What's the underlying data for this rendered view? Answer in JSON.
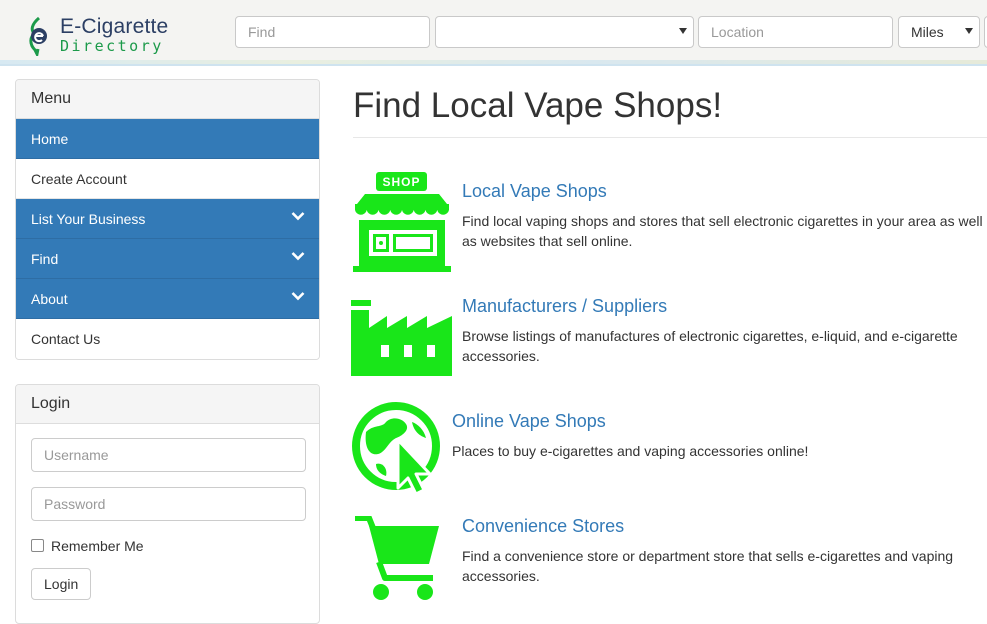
{
  "header": {
    "logo_line1": "E-Cigarette",
    "logo_line2": "Directory",
    "find_placeholder": "Find",
    "category_value": "",
    "location_placeholder": "Location",
    "units_value": "Miles"
  },
  "sidebar": {
    "menu_title": "Menu",
    "menu_items": [
      {
        "label": "Home"
      },
      {
        "label": "Create Account"
      },
      {
        "label": "List Your Business"
      },
      {
        "label": "Find"
      },
      {
        "label": "About"
      },
      {
        "label": "Contact Us"
      }
    ],
    "login_title": "Login",
    "username_placeholder": "Username",
    "password_placeholder": "Password",
    "remember_label": "Remember Me",
    "login_button": "Login"
  },
  "main": {
    "title": "Find Local Vape Shops!",
    "categories": [
      {
        "title": "Local Vape Shops",
        "desc": "Find local vaping shops and stores that sell electronic cigarettes in your area as well as websites that sell online.",
        "icon_text": "SHOP"
      },
      {
        "title": "Manufacturers / Suppliers",
        "desc": "Browse listings of manufactures of electronic cigarettes, e-liquid, and e-cigarette accessories."
      },
      {
        "title": "Online Vape Shops",
        "desc": "Places to buy e-cigarettes and vaping accessories online!"
      },
      {
        "title": "Convenience Stores",
        "desc": "Find a convenience store or department store that sells e-cigarettes and vaping accessories."
      }
    ]
  },
  "colors": {
    "menu_blue": "#337ab7",
    "link_blue": "#337ab7",
    "icon_green": "#19e619"
  }
}
